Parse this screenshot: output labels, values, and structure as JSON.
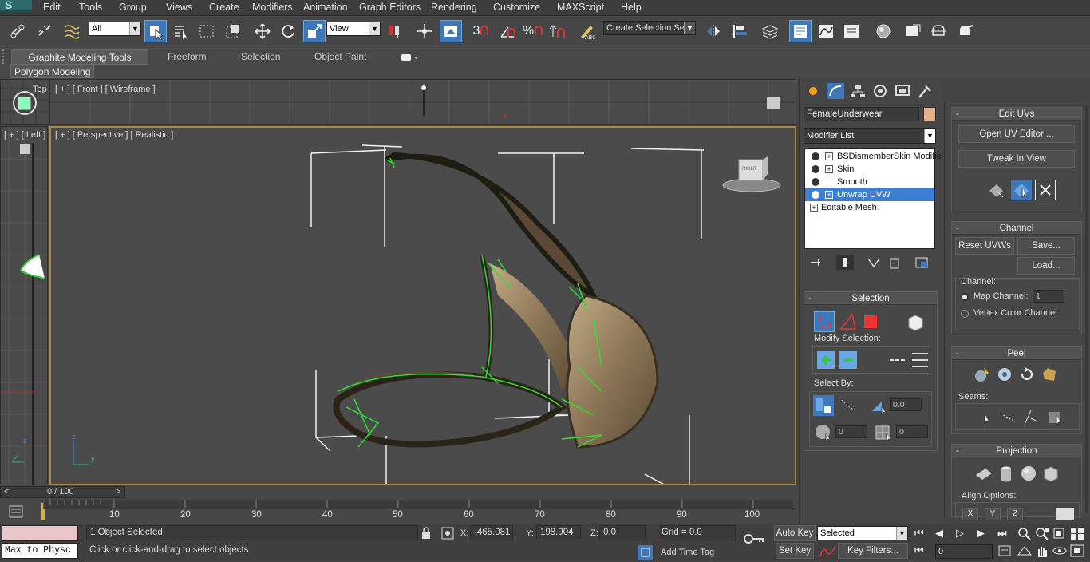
{
  "menu": [
    "Edit",
    "Tools",
    "Group",
    "Views",
    "Create",
    "Modifiers",
    "Animation",
    "Graph Editors",
    "Rendering",
    "Customize",
    "MAXScript",
    "Help"
  ],
  "toolbar": {
    "selection_filter": "All",
    "ref_coord": "View",
    "snap_3": "3",
    "snap_percent": "%",
    "named_selection": "Create Selection Se"
  },
  "ribbon": {
    "tabs": [
      "Graphite Modeling Tools",
      "Freeform",
      "Selection",
      "Object Paint"
    ],
    "panel": "Polygon Modeling"
  },
  "viewports": {
    "front": "[ + ] [ Front ] [ Wireframe ]",
    "left": "[ + ] [ Left ]",
    "top": "Top",
    "perspective": "[ + ] [ Perspective ] [ Realistic ]",
    "viewcube": "RIGHT"
  },
  "command_panel": {
    "object_name": "FemaleUnderwear",
    "object_color": "#e7b08c",
    "modifier_list": "Modifier List",
    "stack": [
      "BSDismemberSkin Modifie",
      "Skin",
      "Smooth",
      "Unwrap UVW",
      "Editable Mesh"
    ],
    "selected_index": 3
  },
  "selection_rollout": {
    "title": "Selection",
    "modify_selection": "Modify Selection:",
    "select_by": "Select By:",
    "angle": "0.0",
    "val_a": "0",
    "val_b": "0"
  },
  "edit_uvs": {
    "title": "Edit UVs",
    "open_uv_editor": "Open UV Editor ...",
    "tweak_in_view": "Tweak In View"
  },
  "channel": {
    "title": "Channel",
    "reset_uvws": "Reset UVWs",
    "save": "Save...",
    "load": "Load...",
    "channel_label": "Channel:",
    "map_channel": "Map Channel:",
    "map_channel_value": "1",
    "vertex_color_channel": "Vertex Color Channel"
  },
  "peel": {
    "title": "Peel",
    "seams": "Seams:"
  },
  "projection": {
    "title": "Projection",
    "align_options": "Align Options:",
    "axes": [
      "X",
      "Y",
      "Z"
    ]
  },
  "timeline": {
    "frame": "0 / 100",
    "ticks": [
      "10",
      "20",
      "30",
      "40",
      "50",
      "60",
      "70",
      "80",
      "90",
      "100"
    ]
  },
  "status": {
    "maxscript": "Max to Physc",
    "selected": "1 Object Selected",
    "prompt": "Click or click-and-drag to select objects",
    "x_label": "X:",
    "x": "-465.081",
    "y_label": "Y:",
    "y": "198.904",
    "z_label": "Z:",
    "z": "0.0",
    "grid": "Grid = 0.0",
    "auto_key": "Auto Key",
    "set_key": "Set Key",
    "key_mode": "Selected",
    "key_filters": "Key Filters...",
    "add_time_tag": "Add Time Tag",
    "frame_field": "0"
  }
}
